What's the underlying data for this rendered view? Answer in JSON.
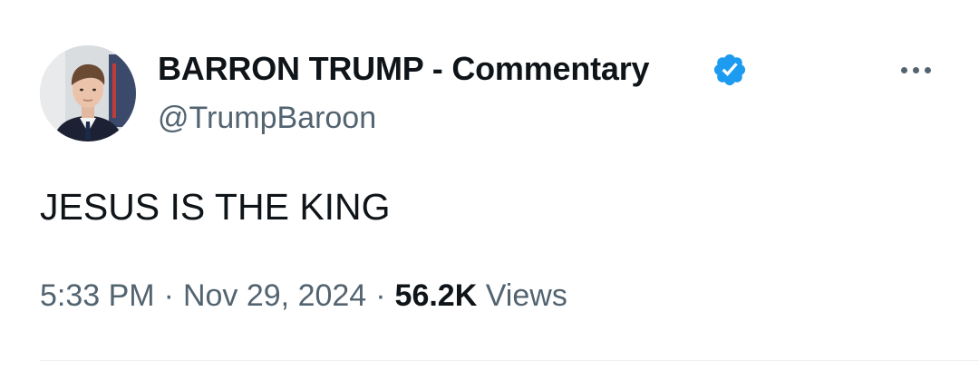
{
  "author": {
    "display_name": "BARRON TRUMP - Commentary",
    "handle": "@TrumpBaroon",
    "verified": true,
    "avatar_icon": "profile-photo"
  },
  "tweet": {
    "text": "JESUS IS THE KING",
    "time": "5:33 PM",
    "date": "Nov 29, 2024",
    "separator": "·",
    "views_count": "56.2K",
    "views_label": "Views"
  },
  "colors": {
    "verified_badge": "#1d9bf0",
    "text_primary": "#0f1419",
    "text_secondary": "#536471"
  }
}
